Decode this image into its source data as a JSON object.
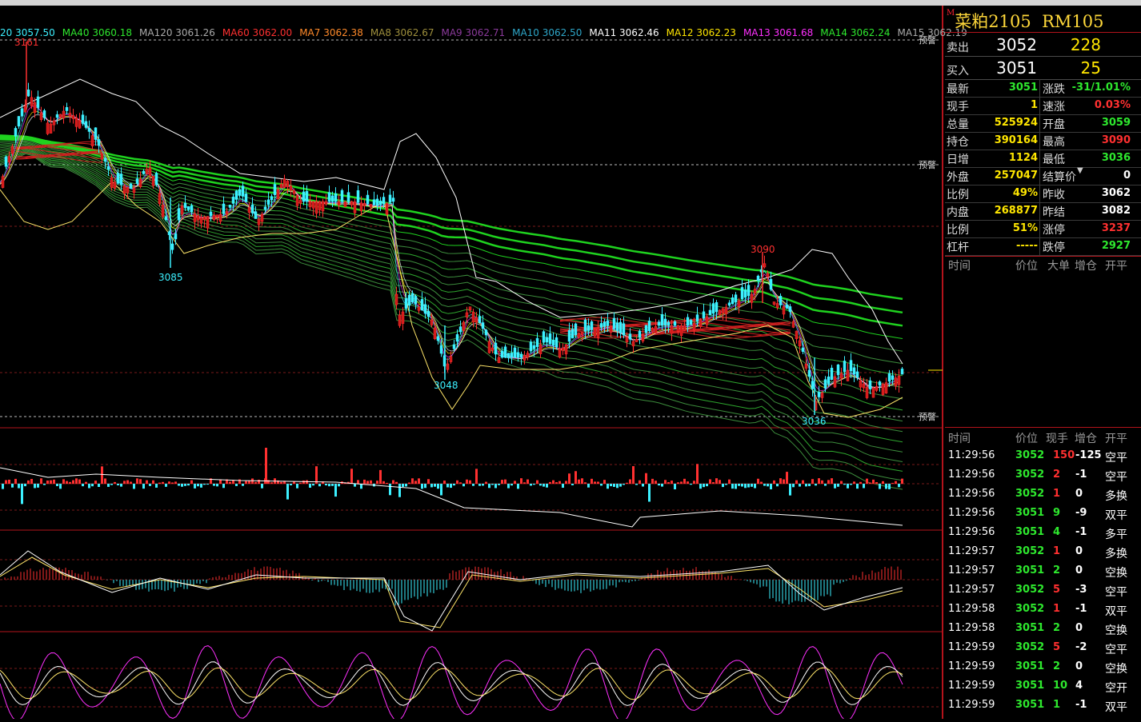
{
  "ma_legend": [
    {
      "label": "20 3057.50",
      "color": "#3cf0ff"
    },
    {
      "label": "MA40 3060.18",
      "color": "#2ee82e"
    },
    {
      "label": "MA120 3061.26",
      "color": "#aaaaaa"
    },
    {
      "label": "MA60 3062.00",
      "color": "#ff3030"
    },
    {
      "label": "MA7 3062.38",
      "color": "#ff8a2a"
    },
    {
      "label": "MA8 3062.67",
      "color": "#9e8f3c"
    },
    {
      "label": "MA9 3062.71",
      "color": "#8a3a9a"
    },
    {
      "label": "MA10 3062.50",
      "color": "#2ea6c8"
    },
    {
      "label": "MA11 3062.46",
      "color": "#ffffff"
    },
    {
      "label": "MA12 3062.23",
      "color": "#ffe600"
    },
    {
      "label": "MA13 3061.68",
      "color": "#ff30ff"
    },
    {
      "label": "MA14 3062.24",
      "color": "#2ee82e"
    },
    {
      "label": "MA15 3062.19",
      "color": "#aaaaaa"
    }
  ],
  "chart_labels": {
    "high": "3161",
    "low1": "3085",
    "low2": "3048",
    "high2": "3090",
    "low3": "3036",
    "alert": "预警"
  },
  "chart_data": {
    "type": "candlestick",
    "annotated_prices": [
      3161,
      3085,
      3048,
      3090,
      3036
    ]
  },
  "contract": {
    "marker": "M",
    "name": "菜粕2105",
    "code": "RM105"
  },
  "orderbook": {
    "sell_label": "卖出",
    "sell_price": "3052",
    "sell_volume": "228",
    "buy_label": "买入",
    "buy_price": "3051",
    "buy_volume": "25"
  },
  "stats_left": [
    {
      "k": "最新",
      "v": "3051",
      "c": "#2ee82e"
    },
    {
      "k": "现手",
      "v": "1",
      "c": "#ffe600"
    },
    {
      "k": "总量",
      "v": "525924",
      "c": "#ffe600"
    },
    {
      "k": "持仓",
      "v": "390164",
      "c": "#ffe600"
    },
    {
      "k": "日增",
      "v": "1124",
      "c": "#ffe600"
    },
    {
      "k": "外盘",
      "v": "257047",
      "c": "#ffe600"
    },
    {
      "k": "比例",
      "v": "49%",
      "c": "#ffe600"
    },
    {
      "k": "内盘",
      "v": "268877",
      "c": "#ffe600"
    },
    {
      "k": "比例",
      "v": "51%",
      "c": "#ffe600"
    },
    {
      "k": "杠杆",
      "v": "-----",
      "c": "#ffe600"
    }
  ],
  "stats_right": [
    {
      "k": "涨跌",
      "v": "-31/1.01%",
      "c": "#2ee82e"
    },
    {
      "k": "速涨",
      "v": "0.03%",
      "c": "#ff3030"
    },
    {
      "k": "开盘",
      "v": "3059",
      "c": "#2ee82e"
    },
    {
      "k": "最高",
      "v": "3090",
      "c": "#ff3030"
    },
    {
      "k": "最低",
      "v": "3036",
      "c": "#2ee82e"
    },
    {
      "k": "结算价",
      "v": "0",
      "c": "#ffffff"
    },
    {
      "k": "昨收",
      "v": "3062",
      "c": "#ffffff"
    },
    {
      "k": "昨结",
      "v": "3082",
      "c": "#ffffff"
    },
    {
      "k": "涨停",
      "v": "3237",
      "c": "#ff3030"
    },
    {
      "k": "跌停",
      "v": "2927",
      "c": "#2ee82e"
    }
  ],
  "big_header": {
    "time": "时间",
    "price": "价位",
    "big": "大单",
    "oi": "增仓",
    "open": "开平"
  },
  "tick_header": {
    "time": "时间",
    "price": "价位",
    "qty": "现手",
    "oi": "增仓",
    "type": "开平"
  },
  "ticks": [
    {
      "time": "11:29:56",
      "price": "3052",
      "qty": "150",
      "oi": "-125",
      "type": "空平",
      "pc": "#2ee82e",
      "qc": "#ff3030"
    },
    {
      "time": "11:29:56",
      "price": "3052",
      "qty": "2",
      "oi": "-1",
      "type": "空平",
      "pc": "#2ee82e",
      "qc": "#ff3030"
    },
    {
      "time": "11:29:56",
      "price": "3052",
      "qty": "1",
      "oi": "0",
      "type": "多换",
      "pc": "#2ee82e",
      "qc": "#ff3030"
    },
    {
      "time": "11:29:56",
      "price": "3051",
      "qty": "9",
      "oi": "-9",
      "type": "双平",
      "pc": "#2ee82e",
      "qc": "#2ee82e"
    },
    {
      "time": "11:29:56",
      "price": "3051",
      "qty": "4",
      "oi": "-1",
      "type": "多平",
      "pc": "#2ee82e",
      "qc": "#2ee82e"
    },
    {
      "time": "11:29:57",
      "price": "3052",
      "qty": "1",
      "oi": "0",
      "type": "多换",
      "pc": "#2ee82e",
      "qc": "#ff3030"
    },
    {
      "time": "11:29:57",
      "price": "3051",
      "qty": "2",
      "oi": "0",
      "type": "空换",
      "pc": "#2ee82e",
      "qc": "#2ee82e"
    },
    {
      "time": "11:29:57",
      "price": "3052",
      "qty": "5",
      "oi": "-3",
      "type": "空平",
      "pc": "#2ee82e",
      "qc": "#ff3030"
    },
    {
      "time": "11:29:58",
      "price": "3052",
      "qty": "1",
      "oi": "-1",
      "type": "双平",
      "pc": "#2ee82e",
      "qc": "#ff3030"
    },
    {
      "time": "11:29:58",
      "price": "3051",
      "qty": "2",
      "oi": "0",
      "type": "空换",
      "pc": "#2ee82e",
      "qc": "#2ee82e"
    },
    {
      "time": "11:29:59",
      "price": "3052",
      "qty": "5",
      "oi": "-2",
      "type": "空平",
      "pc": "#2ee82e",
      "qc": "#ff3030"
    },
    {
      "time": "11:29:59",
      "price": "3051",
      "qty": "2",
      "oi": "0",
      "type": "空换",
      "pc": "#2ee82e",
      "qc": "#2ee82e"
    },
    {
      "time": "11:29:59",
      "price": "3051",
      "qty": "10",
      "oi": "4",
      "type": "空开",
      "pc": "#2ee82e",
      "qc": "#2ee82e"
    },
    {
      "time": "11:29:59",
      "price": "3051",
      "qty": "1",
      "oi": "-1",
      "type": "双平",
      "pc": "#2ee82e",
      "qc": "#2ee82e"
    }
  ]
}
